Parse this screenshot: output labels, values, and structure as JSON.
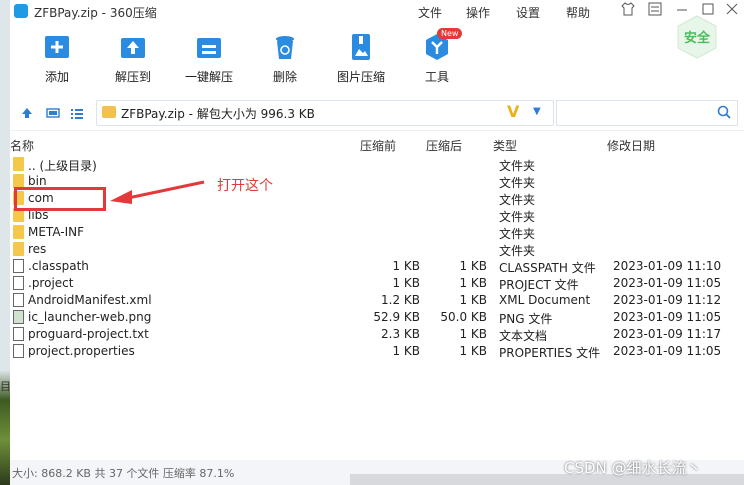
{
  "window": {
    "title": "ZFBPay.zip - 360压缩",
    "menu": [
      "文件",
      "操作",
      "设置",
      "帮助"
    ]
  },
  "toolbar": {
    "items": [
      {
        "label": "添加",
        "icon": "add-icon"
      },
      {
        "label": "解压到",
        "icon": "extract-to-icon"
      },
      {
        "label": "一键解压",
        "icon": "one-click-extract-icon"
      },
      {
        "label": "删除",
        "icon": "delete-icon"
      },
      {
        "label": "图片压缩",
        "icon": "image-compress-icon"
      },
      {
        "label": "工具",
        "icon": "tools-icon"
      }
    ],
    "new_badge": "New",
    "safe_label": "安全"
  },
  "address": {
    "path": "ZFBPay.zip - 解包大小为 996.3 KB",
    "v_mark": "V"
  },
  "columns": {
    "name": "名称",
    "before": "压缩前",
    "after": "压缩后",
    "type": "类型",
    "modified": "修改日期"
  },
  "files": [
    {
      "name": ".. (上级目录)",
      "before": "",
      "after": "",
      "type": "文件夹",
      "date": "",
      "kind": "folder"
    },
    {
      "name": "bin",
      "before": "",
      "after": "",
      "type": "文件夹",
      "date": "",
      "kind": "folder"
    },
    {
      "name": "com",
      "before": "",
      "after": "",
      "type": "文件夹",
      "date": "",
      "kind": "folder"
    },
    {
      "name": "libs",
      "before": "",
      "after": "",
      "type": "文件夹",
      "date": "",
      "kind": "folder"
    },
    {
      "name": "META-INF",
      "before": "",
      "after": "",
      "type": "文件夹",
      "date": "",
      "kind": "folder"
    },
    {
      "name": "res",
      "before": "",
      "after": "",
      "type": "文件夹",
      "date": "",
      "kind": "folder"
    },
    {
      "name": ".classpath",
      "before": "1 KB",
      "after": "1 KB",
      "type": "CLASSPATH 文件",
      "date": "2023-01-09 11:10",
      "kind": "file"
    },
    {
      "name": ".project",
      "before": "1 KB",
      "after": "1 KB",
      "type": "PROJECT 文件",
      "date": "2023-01-09 11:05",
      "kind": "file"
    },
    {
      "name": "AndroidManifest.xml",
      "before": "1.2 KB",
      "after": "1 KB",
      "type": "XML Document",
      "date": "2023-01-09 11:12",
      "kind": "file"
    },
    {
      "name": "ic_launcher-web.png",
      "before": "52.9 KB",
      "after": "50.0 KB",
      "type": "PNG 文件",
      "date": "2023-01-09 11:05",
      "kind": "image"
    },
    {
      "name": "proguard-project.txt",
      "before": "2.3 KB",
      "after": "1 KB",
      "type": "文本文档",
      "date": "2023-01-09 11:17",
      "kind": "file"
    },
    {
      "name": "project.properties",
      "before": "1 KB",
      "after": "1 KB",
      "type": "PROPERTIES 文件",
      "date": "2023-01-09 11:05",
      "kind": "file"
    }
  ],
  "annotation": {
    "text": "打开这个",
    "color": "#e23a3a"
  },
  "status": {
    "text": "大小: 868.2 KB 共 37 个文件 压缩率 87.1%"
  },
  "watermark": "CSDN @细水长流丶",
  "desktop_edge_char": "目"
}
